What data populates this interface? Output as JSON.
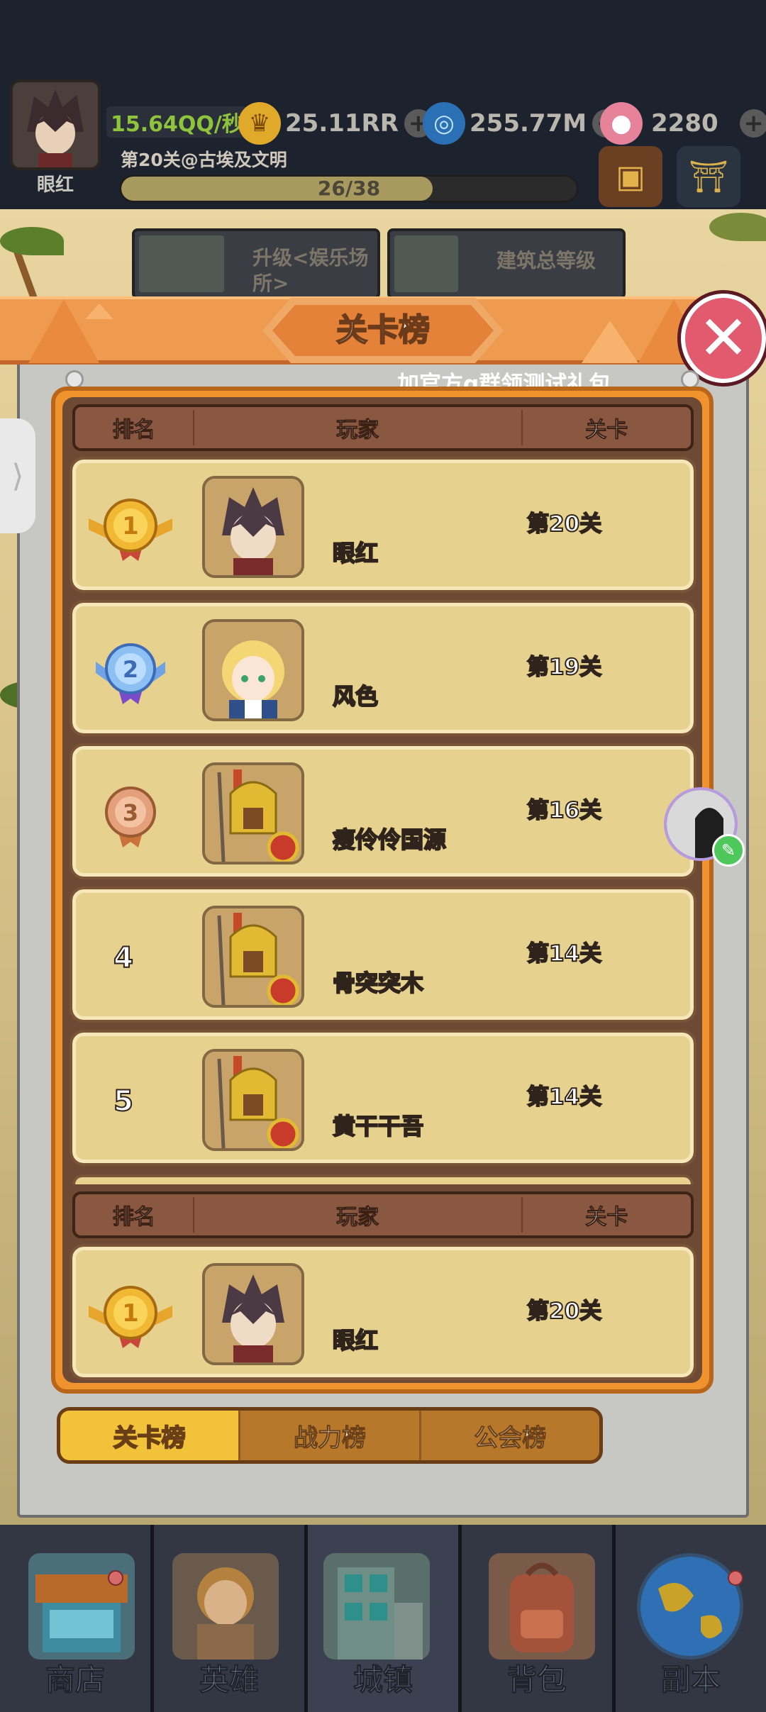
{
  "hud": {
    "player_name": "眼红",
    "income": "15.64QQ/秒",
    "stage_desc": "第20关@古埃及文明",
    "progress_text": "26/38",
    "progress_fraction": 0.684,
    "currencies": [
      {
        "icon": "crown-icon",
        "value": "25.11RR"
      },
      {
        "icon": "gem-swirl-icon",
        "value": "255.77M"
      },
      {
        "icon": "pink-gem-icon",
        "value": "2280"
      }
    ],
    "buttons": [
      {
        "icon": "treasure-chest-icon"
      },
      {
        "icon": "portal-gate-icon"
      }
    ]
  },
  "quests": [
    {
      "label": "升级<娱乐场所>"
    },
    {
      "label": "建筑总等级"
    }
  ],
  "modal": {
    "title": "关卡榜",
    "close_label": "✕",
    "tip": "加官方q群领测试礼包",
    "columns": [
      "排名",
      "玩家",
      "关卡"
    ],
    "rows": [
      {
        "rank": "1",
        "rank_style": "gold-medal",
        "name": "眼红",
        "level": "第20关",
        "avatar": "dark-hair-warrior"
      },
      {
        "rank": "2",
        "rank_style": "blue-medal",
        "name": "风色",
        "level": "第19关",
        "avatar": "blonde-knight-girl"
      },
      {
        "rank": "3",
        "rank_style": "bronze-medal",
        "name": "瘦伶伶国源",
        "level": "第16关",
        "avatar": "spartan-soldier"
      },
      {
        "rank": "4",
        "rank_style": "number",
        "name": "骨突突木",
        "level": "第14关",
        "avatar": "spartan-soldier"
      },
      {
        "rank": "5",
        "rank_style": "number",
        "name": "黄干干吾",
        "level": "第14关",
        "avatar": "spartan-soldier"
      }
    ],
    "self_row": {
      "rank": "1",
      "rank_style": "gold-medal",
      "name": "眼红",
      "level": "第20关",
      "avatar": "dark-hair-warrior"
    },
    "tabs": [
      {
        "label": "关卡榜",
        "active": true
      },
      {
        "label": "战力榜",
        "active": false
      },
      {
        "label": "公会榜",
        "active": false
      }
    ]
  },
  "side": {
    "handle_glyph": "⟩"
  },
  "bottom_nav": [
    {
      "label": "商店",
      "icon": "shop-icon",
      "dot": true
    },
    {
      "label": "英雄",
      "icon": "hero-icon",
      "dot": false
    },
    {
      "label": "城镇",
      "icon": "town-icon",
      "dot": false
    },
    {
      "label": "背包",
      "icon": "backpack-icon",
      "dot": false
    },
    {
      "label": "副本",
      "icon": "globe-icon",
      "dot": true
    }
  ],
  "colors": {
    "header_orange": "#ee9a4f",
    "row_cream": "#e6d18f",
    "active_tab": "#f2c23a",
    "close_red": "#e15a6e"
  }
}
